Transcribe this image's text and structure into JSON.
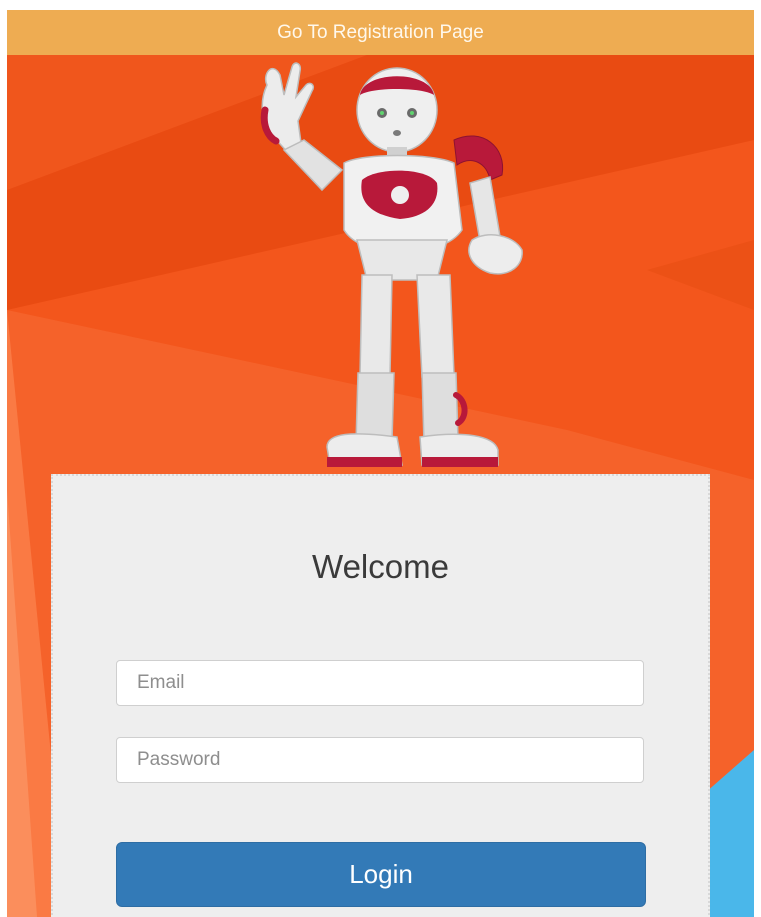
{
  "header": {
    "registration_link": "Go To Registration Page"
  },
  "login_panel": {
    "title": "Welcome",
    "email_placeholder": "Email",
    "email_value": "",
    "password_placeholder": "Password",
    "password_value": "",
    "login_label": "Login"
  },
  "colors": {
    "topbar": "#eeac52",
    "background": "#f05a1e",
    "panel": "#eeeeee",
    "login_button": "#337ab7",
    "robot_accent": "#b8193a"
  },
  "images": {
    "robot": "robot-illustration"
  }
}
